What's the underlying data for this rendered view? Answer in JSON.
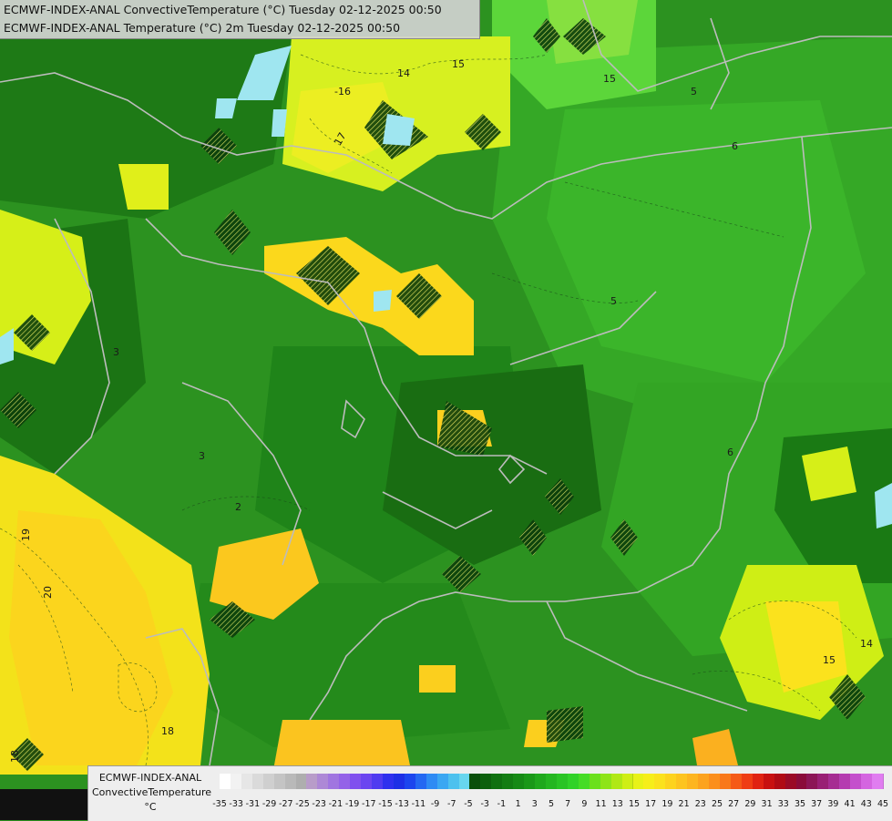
{
  "header": {
    "line1": "ECMWF-INDEX-ANAL ConvectiveTemperature (°C) Tuesday 02-12-2025 00:50",
    "line2": "ECMWF-INDEX-ANAL Temperature (°C) 2m Tuesday 02-12-2025 00:50"
  },
  "legend": {
    "title1": "ECMWF-INDEX-ANAL",
    "title2": "ConvectiveTemperature",
    "unit": "°C",
    "ticks": [
      "-35",
      "-33",
      "-31",
      "-29",
      "-27",
      "-25",
      "-23",
      "-21",
      "-19",
      "-17",
      "-15",
      "-13",
      "-11",
      "-9",
      "-7",
      "-5",
      "-3",
      "-1",
      "1",
      "3",
      "5",
      "7",
      "9",
      "11",
      "13",
      "15",
      "17",
      "19",
      "21",
      "23",
      "25",
      "27",
      "29",
      "31",
      "33",
      "35",
      "37",
      "39",
      "41",
      "43",
      "45"
    ],
    "colors": [
      "#ffffff",
      "#f2f2f2",
      "#e6e6e6",
      "#dadada",
      "#cfcfcf",
      "#c4c4c4",
      "#b9b9b9",
      "#aeaeae",
      "#b89cc9",
      "#ad88d6",
      "#a075e0",
      "#9462e8",
      "#8050ee",
      "#6b45f0",
      "#4f3bf0",
      "#2e30ee",
      "#1d2fe6",
      "#1c45ee",
      "#2468f2",
      "#2e8bf4",
      "#3aa7f2",
      "#4cc1ee",
      "#67d6ee",
      "#0a4f0a",
      "#0c600c",
      "#0f700f",
      "#137d12",
      "#168a15",
      "#1a9818",
      "#1fa81c",
      "#24b620",
      "#29c424",
      "#30d228",
      "#45dc25",
      "#6be01c",
      "#8ee418",
      "#b0e815",
      "#cfee15",
      "#e8f218",
      "#f6ee1a",
      "#fbe21d",
      "#fdd31e",
      "#fdc41f",
      "#fdb51f",
      "#fca31e",
      "#fb8f1c",
      "#f9781a",
      "#f55a17",
      "#ef3d14",
      "#e02212",
      "#c81010",
      "#b00a14",
      "#9a0a26",
      "#8a0b3a",
      "#8c1556",
      "#991f74",
      "#a62c92",
      "#b53cb0",
      "#c44fcc",
      "#d465e0",
      "#e07df0"
    ],
    "selected_range": "-35 to 45"
  },
  "map": {
    "contour_labels": [
      "-16",
      "17",
      "14",
      "15",
      "15",
      "5",
      "6",
      "3",
      "2",
      "3",
      "5",
      "19",
      "20",
      "18",
      "6",
      "15",
      "14",
      "18"
    ]
  }
}
